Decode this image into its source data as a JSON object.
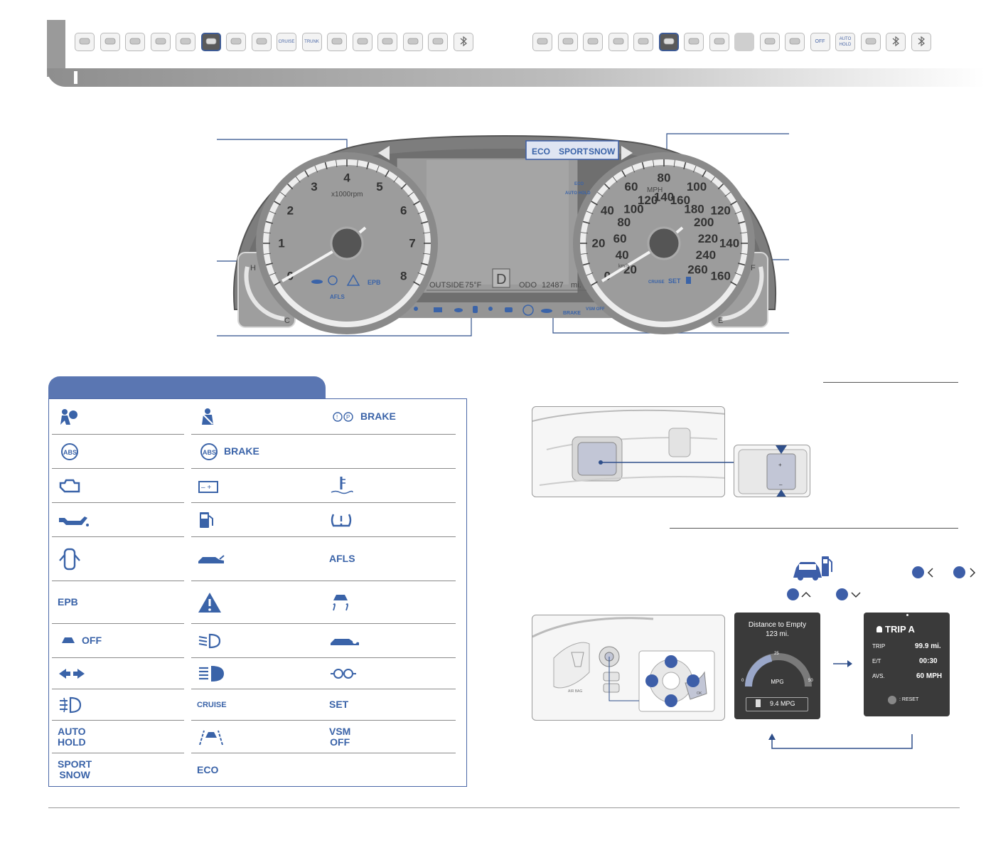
{
  "header": {
    "left_tabs": [
      {
        "icon": "key-icon"
      },
      {
        "icon": "mirror-icon"
      },
      {
        "icon": "wrench-icon"
      },
      {
        "icon": "window-icon"
      },
      {
        "icon": "seat-icon"
      },
      {
        "icon": "cluster-icon",
        "active": true
      },
      {
        "icon": "gauge-icon"
      },
      {
        "icon": "wiper-icon"
      },
      {
        "icon": "cruise-icon",
        "label": "CRUISE"
      },
      {
        "icon": "trunk-icon",
        "label": "TRUNK"
      },
      {
        "icon": "climate-icon"
      },
      {
        "icon": "tpms-icon"
      },
      {
        "icon": "screen-icon"
      },
      {
        "icon": "info-icon"
      },
      {
        "icon": "radio-icon"
      },
      {
        "icon": "bluetooth-icon"
      }
    ],
    "right_tabs": [
      {
        "icon": "key-icon"
      },
      {
        "icon": "wheel-icon"
      },
      {
        "icon": "mirror-icon"
      },
      {
        "icon": "door-icon"
      },
      {
        "icon": "light-icon"
      },
      {
        "icon": "cluster-icon",
        "active": true
      },
      {
        "icon": "gauge-icon"
      },
      {
        "icon": "panel-icon"
      },
      {
        "icon": "blank-icon",
        "grey": true
      },
      {
        "icon": "screen-icon"
      },
      {
        "icon": "hand-icon"
      },
      {
        "icon": "car-off-icon",
        "label": "OFF"
      },
      {
        "icon": "auto-hold-icon",
        "label": "AUTO HOLD"
      },
      {
        "icon": "climate-icon"
      },
      {
        "icon": "bluetooth-icon"
      },
      {
        "icon": "bluetooth-icon"
      }
    ]
  },
  "cluster": {
    "tach_numbers": [
      "0",
      "1",
      "2",
      "3",
      "4",
      "5",
      "6",
      "7",
      "8"
    ],
    "tach_unit": "x1000rpm",
    "temp_h": "H",
    "temp_c": "C",
    "fuel_f": "F",
    "fuel_e": "E",
    "speed_mph": [
      "0",
      "20",
      "40",
      "60",
      "80",
      "100",
      "120",
      "140",
      "160"
    ],
    "speed_kmh": [
      "20",
      "40",
      "60",
      "80",
      "100",
      "120",
      "140",
      "160",
      "180",
      "200",
      "220",
      "240",
      "260"
    ],
    "speed_unit": "MPH",
    "speed_unit_kmh": "km/h",
    "mode_labels": [
      "ECO",
      "SPORT",
      "SNOW"
    ],
    "eco_badge": "ECO",
    "auto_hold": "AUTO HOLD",
    "outside_label": "OUTSIDE",
    "outside_value": "75°F",
    "gear": "D",
    "odo_label": "ODO",
    "odo_value": "12487",
    "odo_unit": "mi.",
    "afls": "AFLS",
    "epb": "EPB",
    "cruise": "CRUISE",
    "set": "SET",
    "vsm_off": "VSM OFF",
    "brake_label": "BRAKE"
  },
  "indicators": [
    {
      "icon": "airbag-icon"
    },
    {
      "icon": "seatbelt-icon"
    },
    {
      "icon": "parking-brake-icon",
      "text": "BRAKE"
    },
    {
      "icon": "abs-icon"
    },
    {
      "icon": "abs-brake-icon",
      "text": "BRAKE"
    },
    {
      "icon": "empty"
    },
    {
      "icon": "check-engine-icon"
    },
    {
      "icon": "battery-icon"
    },
    {
      "icon": "coolant-temp-icon"
    },
    {
      "icon": "oil-pressure-icon"
    },
    {
      "icon": "low-fuel-icon"
    },
    {
      "icon": "tpms-icon"
    },
    {
      "icon": "door-open-icon"
    },
    {
      "icon": "trunk-open-icon"
    },
    {
      "icon": "afls-icon",
      "text": "AFLS"
    },
    {
      "icon": "epb-icon",
      "text": "EPB"
    },
    {
      "icon": "master-warning-icon"
    },
    {
      "icon": "esc-icon"
    },
    {
      "icon": "esc-off-icon",
      "text": "OFF"
    },
    {
      "icon": "low-beam-icon"
    },
    {
      "icon": "immobilizer-icon"
    },
    {
      "icon": "turn-signal-icon"
    },
    {
      "icon": "high-beam-icon"
    },
    {
      "icon": "light-on-icon"
    },
    {
      "icon": "fog-light-icon"
    },
    {
      "icon": "cruise-icon",
      "text": "CRUISE"
    },
    {
      "icon": "set-icon",
      "text": "SET"
    },
    {
      "icon": "auto-hold-icon",
      "text": "AUTO HOLD"
    },
    {
      "icon": "lane-departure-icon"
    },
    {
      "icon": "vsm-off-icon",
      "text": "VSM OFF"
    },
    {
      "icon": "sport-snow-icon",
      "text": "SPORT SNOW"
    },
    {
      "icon": "eco-icon",
      "text": "ECO"
    },
    {
      "icon": "empty"
    }
  ],
  "lcd_left": {
    "title": "Distance to Empty",
    "value": "123 mi.",
    "gauge_min": "0",
    "gauge_max": "50",
    "gauge_mid": "25",
    "gauge_label": "MPG",
    "mpg_value": "9.4 MPG"
  },
  "lcd_right": {
    "title": "TRIP A",
    "rows": [
      {
        "label": "TRIP",
        "value": "99.9 mi."
      },
      {
        "label": "E/T",
        "value": "00:30"
      },
      {
        "label": "AVS.",
        "value": "60 MPH"
      }
    ],
    "reset": ": RESET"
  },
  "colors": {
    "accent_blue": "#3d5ea8",
    "table_header": "#5a76b2",
    "cluster_grey": "#7d7d7d"
  }
}
